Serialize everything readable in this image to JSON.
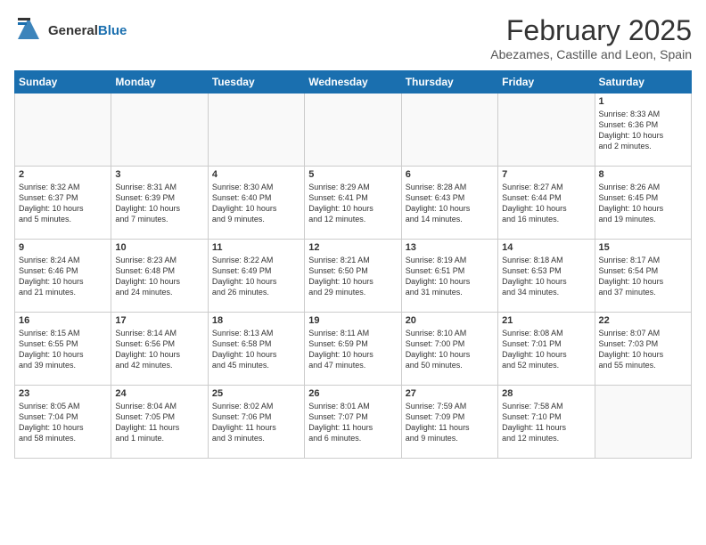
{
  "logo": {
    "general": "General",
    "blue": "Blue"
  },
  "header": {
    "month": "February 2025",
    "location": "Abezames, Castille and Leon, Spain"
  },
  "weekdays": [
    "Sunday",
    "Monday",
    "Tuesday",
    "Wednesday",
    "Thursday",
    "Friday",
    "Saturday"
  ],
  "weeks": [
    [
      {
        "day": "",
        "info": ""
      },
      {
        "day": "",
        "info": ""
      },
      {
        "day": "",
        "info": ""
      },
      {
        "day": "",
        "info": ""
      },
      {
        "day": "",
        "info": ""
      },
      {
        "day": "",
        "info": ""
      },
      {
        "day": "1",
        "info": "Sunrise: 8:33 AM\nSunset: 6:36 PM\nDaylight: 10 hours\nand 2 minutes."
      }
    ],
    [
      {
        "day": "2",
        "info": "Sunrise: 8:32 AM\nSunset: 6:37 PM\nDaylight: 10 hours\nand 5 minutes."
      },
      {
        "day": "3",
        "info": "Sunrise: 8:31 AM\nSunset: 6:39 PM\nDaylight: 10 hours\nand 7 minutes."
      },
      {
        "day": "4",
        "info": "Sunrise: 8:30 AM\nSunset: 6:40 PM\nDaylight: 10 hours\nand 9 minutes."
      },
      {
        "day": "5",
        "info": "Sunrise: 8:29 AM\nSunset: 6:41 PM\nDaylight: 10 hours\nand 12 minutes."
      },
      {
        "day": "6",
        "info": "Sunrise: 8:28 AM\nSunset: 6:43 PM\nDaylight: 10 hours\nand 14 minutes."
      },
      {
        "day": "7",
        "info": "Sunrise: 8:27 AM\nSunset: 6:44 PM\nDaylight: 10 hours\nand 16 minutes."
      },
      {
        "day": "8",
        "info": "Sunrise: 8:26 AM\nSunset: 6:45 PM\nDaylight: 10 hours\nand 19 minutes."
      }
    ],
    [
      {
        "day": "9",
        "info": "Sunrise: 8:24 AM\nSunset: 6:46 PM\nDaylight: 10 hours\nand 21 minutes."
      },
      {
        "day": "10",
        "info": "Sunrise: 8:23 AM\nSunset: 6:48 PM\nDaylight: 10 hours\nand 24 minutes."
      },
      {
        "day": "11",
        "info": "Sunrise: 8:22 AM\nSunset: 6:49 PM\nDaylight: 10 hours\nand 26 minutes."
      },
      {
        "day": "12",
        "info": "Sunrise: 8:21 AM\nSunset: 6:50 PM\nDaylight: 10 hours\nand 29 minutes."
      },
      {
        "day": "13",
        "info": "Sunrise: 8:19 AM\nSunset: 6:51 PM\nDaylight: 10 hours\nand 31 minutes."
      },
      {
        "day": "14",
        "info": "Sunrise: 8:18 AM\nSunset: 6:53 PM\nDaylight: 10 hours\nand 34 minutes."
      },
      {
        "day": "15",
        "info": "Sunrise: 8:17 AM\nSunset: 6:54 PM\nDaylight: 10 hours\nand 37 minutes."
      }
    ],
    [
      {
        "day": "16",
        "info": "Sunrise: 8:15 AM\nSunset: 6:55 PM\nDaylight: 10 hours\nand 39 minutes."
      },
      {
        "day": "17",
        "info": "Sunrise: 8:14 AM\nSunset: 6:56 PM\nDaylight: 10 hours\nand 42 minutes."
      },
      {
        "day": "18",
        "info": "Sunrise: 8:13 AM\nSunset: 6:58 PM\nDaylight: 10 hours\nand 45 minutes."
      },
      {
        "day": "19",
        "info": "Sunrise: 8:11 AM\nSunset: 6:59 PM\nDaylight: 10 hours\nand 47 minutes."
      },
      {
        "day": "20",
        "info": "Sunrise: 8:10 AM\nSunset: 7:00 PM\nDaylight: 10 hours\nand 50 minutes."
      },
      {
        "day": "21",
        "info": "Sunrise: 8:08 AM\nSunset: 7:01 PM\nDaylight: 10 hours\nand 52 minutes."
      },
      {
        "day": "22",
        "info": "Sunrise: 8:07 AM\nSunset: 7:03 PM\nDaylight: 10 hours\nand 55 minutes."
      }
    ],
    [
      {
        "day": "23",
        "info": "Sunrise: 8:05 AM\nSunset: 7:04 PM\nDaylight: 10 hours\nand 58 minutes."
      },
      {
        "day": "24",
        "info": "Sunrise: 8:04 AM\nSunset: 7:05 PM\nDaylight: 11 hours\nand 1 minute."
      },
      {
        "day": "25",
        "info": "Sunrise: 8:02 AM\nSunset: 7:06 PM\nDaylight: 11 hours\nand 3 minutes."
      },
      {
        "day": "26",
        "info": "Sunrise: 8:01 AM\nSunset: 7:07 PM\nDaylight: 11 hours\nand 6 minutes."
      },
      {
        "day": "27",
        "info": "Sunrise: 7:59 AM\nSunset: 7:09 PM\nDaylight: 11 hours\nand 9 minutes."
      },
      {
        "day": "28",
        "info": "Sunrise: 7:58 AM\nSunset: 7:10 PM\nDaylight: 11 hours\nand 12 minutes."
      },
      {
        "day": "",
        "info": ""
      }
    ]
  ]
}
